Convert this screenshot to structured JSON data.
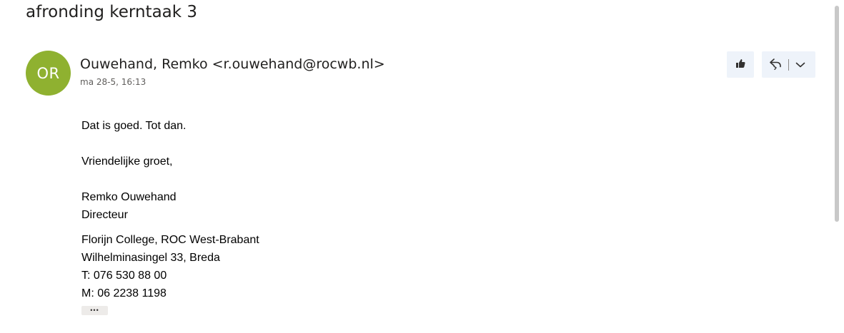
{
  "subject": "afronding kerntaak 3",
  "message": {
    "avatar_initials": "OR",
    "avatar_color": "#8fb130",
    "sender": "Ouwehand, Remko <r.ouwehand@rocwb.nl>",
    "timestamp": "ma 28-5, 16:13",
    "actions": {
      "like_icon": "thumbs-up-icon",
      "reply_icon": "reply-all-icon",
      "more_icon": "chevron-down-icon"
    },
    "body": {
      "line1": "Dat is goed. Tot dan.",
      "greeting": "Vriendelijke groet,",
      "name": "Remko Ouwehand",
      "title": "Directeur",
      "org": "Florijn College, ROC West-Brabant",
      "address": "Wilhelminasingel 33, Breda",
      "phone": "T: 076 530 88 00",
      "mobile": "M: 06 2238 1198"
    },
    "show_more_label": "•••"
  }
}
